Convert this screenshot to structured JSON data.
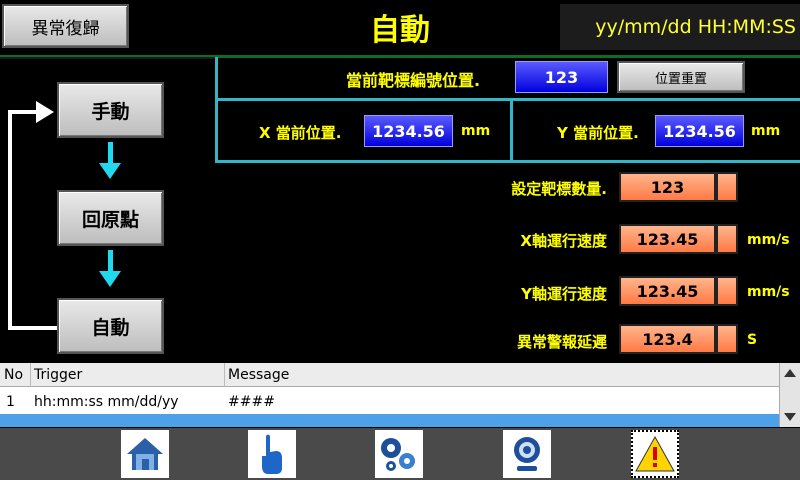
{
  "header": {
    "reset_label": "異常復歸",
    "title": "自動",
    "datetime": "yy/mm/dd  HH:MM:SS"
  },
  "target": {
    "label": "當前靶標編號位置.",
    "value": "123",
    "reset_label": "位置重置"
  },
  "position": {
    "x_label": "X 當前位置.",
    "x_value": "1234.56",
    "x_unit": "mm",
    "y_label": "Y 當前位置.",
    "y_value": "1234.56",
    "y_unit": "mm"
  },
  "settings": [
    {
      "label": "設定靶標數量.",
      "value": "123",
      "unit": ""
    },
    {
      "label": "X軸運行速度",
      "value": "123.45",
      "unit": "mm/s"
    },
    {
      "label": "Y軸運行速度",
      "value": "123.45",
      "unit": "mm/s"
    },
    {
      "label": "異常警報延遲",
      "value": "123.4",
      "unit": "S"
    }
  ],
  "modes": [
    {
      "label": "手動"
    },
    {
      "label": "回原點"
    },
    {
      "label": "自動"
    }
  ],
  "alarm_table": {
    "headers": [
      "No",
      "Trigger",
      "Message"
    ],
    "rows": [
      {
        "no": "1",
        "trigger": "hh:mm:ss mm/dd/yy",
        "message": "####"
      }
    ]
  },
  "footer": {
    "icons": [
      "home-icon",
      "hand-pointer-icon",
      "gears-icon",
      "webcam-icon",
      "warning-icon"
    ]
  },
  "colors": {
    "accent_yellow": "#ffff00",
    "frame_cyan": "#33b5c8",
    "value_blue": "#0000dd",
    "value_orange": "#ff7a45",
    "arrow_cyan": "#22d8ee"
  }
}
